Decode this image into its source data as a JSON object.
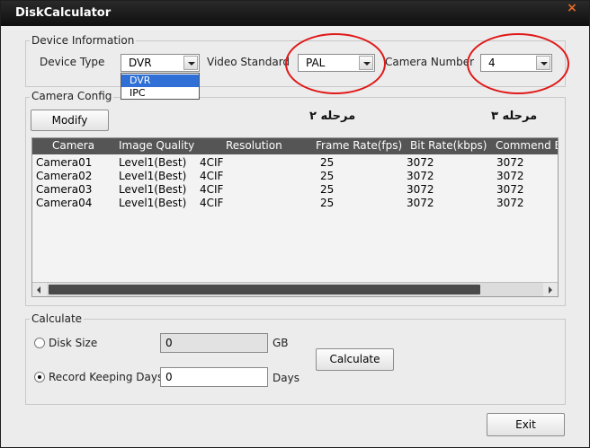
{
  "window": {
    "title": "DiskCalculator",
    "close_glyph": "×"
  },
  "device_info": {
    "group_label": "Device Information",
    "device_type_label": "Device Type",
    "device_type_value": "DVR",
    "device_type_options": [
      "DVR",
      "IPC"
    ],
    "video_standard_label": "Video Standard",
    "video_standard_value": "PAL",
    "camera_number_label": "Camera Number",
    "camera_number_value": "4"
  },
  "camera_config": {
    "group_label": "Camera Config",
    "modify_label": "Modify",
    "annotation_step2": "مرحله ۲",
    "annotation_step3": "مرحله ۳",
    "columns": [
      "Camera",
      "Image Quality",
      "Resolution",
      "Frame Rate(fps)",
      "Bit Rate(kbps)",
      "Commend B"
    ],
    "rows": [
      [
        "Camera01",
        "Level1(Best)",
        "4CIF",
        "25",
        "3072",
        "3072"
      ],
      [
        "Camera02",
        "Level1(Best)",
        "4CIF",
        "25",
        "3072",
        "3072"
      ],
      [
        "Camera03",
        "Level1(Best)",
        "4CIF",
        "25",
        "3072",
        "3072"
      ],
      [
        "Camera04",
        "Level1(Best)",
        "4CIF",
        "25",
        "3072",
        "3072"
      ]
    ]
  },
  "calculate": {
    "group_label": "Calculate",
    "disk_size_label": "Disk Size",
    "disk_size_value": "0",
    "disk_size_unit": "GB",
    "record_days_label": "Record Keeping Days",
    "record_days_value": "0",
    "record_days_unit": "Days",
    "calculate_label": "Calculate",
    "selected_mode": "record_days"
  },
  "footer": {
    "exit_label": "Exit"
  },
  "colors": {
    "annotation_ring": "#e01818",
    "header_bg": "#555555",
    "selection": "#2f6fd6"
  }
}
